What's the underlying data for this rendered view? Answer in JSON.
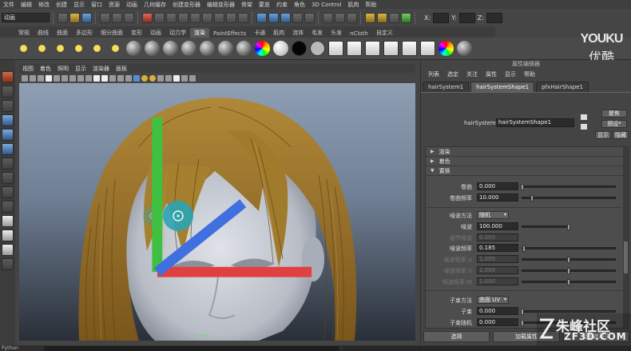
{
  "menubar": {
    "items": [
      "文件",
      "编辑",
      "修改",
      "创建",
      "显示",
      "窗口",
      "资源",
      "动画",
      "几何缓存",
      "创建变形器",
      "编辑变形器",
      "骨架",
      "蒙皮",
      "约束",
      "角色",
      "3D Control",
      "肌肉",
      "帮助"
    ]
  },
  "status": {
    "mode": "动画",
    "x_label": "X:",
    "y_label": "Y:",
    "z_label": "Z:"
  },
  "shelf": {
    "tabs": [
      "常规",
      "曲线",
      "曲面",
      "多边形",
      "细分曲面",
      "变形",
      "动画",
      "动力学",
      "渲染",
      "PaintEffects",
      "卡通",
      "肌肉",
      "流体",
      "毛发",
      "头发",
      "nCloth",
      "自定义"
    ],
    "active_tab": "渲染"
  },
  "watermark": {
    "line1": "YOUKU",
    "line2": "优酷"
  },
  "viewport": {
    "menu": [
      "视图",
      "着色",
      "照明",
      "显示",
      "渲染器",
      "面板"
    ],
    "camera_label": "persp",
    "colors": {
      "hair": "#a07a2e",
      "hair_dark": "#6e4f18",
      "skin": "#c9cdd4",
      "manip": "#2aa5b5"
    }
  },
  "attr_editor": {
    "title": "属性编辑器",
    "menu": [
      "列表",
      "选定",
      "关注",
      "属性",
      "显示",
      "帮助"
    ],
    "tabs": [
      "hairSystem1",
      "hairSystemShape1",
      "pfxHairShape1"
    ],
    "active_tab": "hairSystemShape1",
    "node_label": "hairSystem:",
    "node_value": "hairSystemShape1",
    "btn_focus": "聚焦",
    "btn_presets": "预设*",
    "btn_show": "显示",
    "btn_hide": "隐藏",
    "sections": [
      {
        "label": "渲染",
        "open": false
      },
      {
        "label": "着色",
        "open": false
      },
      {
        "label": "置换",
        "open": true
      }
    ],
    "attrs": {
      "curl": {
        "label": "卷曲",
        "value": "0.000",
        "fraction": 0.0
      },
      "curl_freq": {
        "label": "卷曲频率",
        "value": "10.000",
        "fraction": 0.1
      },
      "noise_method": {
        "label": "噪波方法",
        "value": "随机"
      },
      "noise": {
        "label": "噪波",
        "value": "100.000",
        "fraction": 1.0
      },
      "detail_noise": {
        "label": "细节噪波",
        "value": "0.000",
        "fraction": 0.0
      },
      "noise_freq": {
        "label": "噪波频率",
        "value": "0.185",
        "fraction": 0.02
      },
      "noise_freq_u": {
        "label": "噪波频率 U",
        "value": "1.000",
        "fraction": 0.5
      },
      "noise_freq_v": {
        "label": "噪波频率 V",
        "value": "1.000",
        "fraction": 0.5
      },
      "noise_freq_w": {
        "label": "噪波频率 W",
        "value": "1.000",
        "fraction": 0.5
      },
      "sub_method": {
        "label": "子束方法",
        "value": "曲面 UV"
      },
      "sub_clumps": {
        "label": "子束",
        "value": "0.000",
        "fraction": 0.0
      },
      "sub_rand": {
        "label": "子束随机",
        "value": "0.000",
        "fraction": 0.0
      }
    },
    "bottom": {
      "select": "选择",
      "load": "加载属性",
      "copy": "复制选项卡"
    }
  },
  "corner_wm": {
    "line1": "朱峰社区",
    "line2": "ZF3D.COM"
  },
  "cmdline": {
    "label": "Python"
  }
}
